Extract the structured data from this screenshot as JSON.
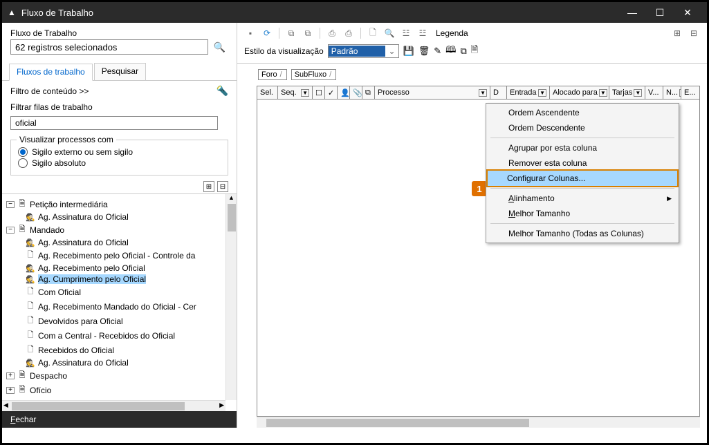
{
  "titlebar": {
    "title": "Fluxo de Trabalho"
  },
  "leftHeader": {
    "label": "Fluxo de Trabalho",
    "searchValue": "62 registros selecionados"
  },
  "tabs": {
    "flow": "Fluxos de trabalho",
    "search": "Pesquisar"
  },
  "filter": {
    "contentLabel": "Filtro de conteúdo >>",
    "queueLabel": "Filtrar filas de trabalho",
    "queueValue": "oficial"
  },
  "vbox": {
    "legend": "Visualizar processos com",
    "radio1": "Sigilo externo ou sem sigilo",
    "radio2": "Sigilo absoluto"
  },
  "tree": {
    "peticao": "Petição intermediária",
    "assinatura1": "Ag. Assinatura do Oficial",
    "mandado": "Mandado",
    "assinatura2": "Ag. Assinatura do Oficial",
    "recControle": "Ag. Recebimento pelo Oficial - Controle da",
    "recOficial": "Ag. Recebimento pelo Oficial",
    "cumprimento": "Ag. Cumprimento pelo Oficial",
    "comOficial": "Com Oficial",
    "recMandado": "Ag. Recebimento Mandado do Oficial - Cer",
    "devolvidos": "Devolvidos para Oficial",
    "comCentral": "Com a Central - Recebidos do Oficial",
    "recebidos": "Recebidos do Oficial",
    "assinatura3": "Ag. Assinatura do Oficial",
    "despacho": "Despacho",
    "oficio": "Ofício"
  },
  "footer": {
    "closeRest": "echar",
    "closeU": "F"
  },
  "toolbar": {
    "legend": "Legenda",
    "styleLabel": "Estilo da visualização",
    "styleValue": "Padrão"
  },
  "crumbs": {
    "foro": "Foro",
    "subfluxo": "SubFluxo"
  },
  "gridHeaders": {
    "sel": "Sel.",
    "seq": "Seq.",
    "processo": "Processo",
    "d": "D",
    "entrada": "Entrada",
    "alocado": "Alocado para",
    "tarjas": "Tarjas",
    "v": "V...",
    "n": "N...",
    "e": "E..."
  },
  "contextMenu": {
    "asc": "Ordem Ascendente",
    "desc": "Ordem Descendente",
    "group": "Agrupar por esta coluna",
    "remove": "Remover esta coluna",
    "configure": "Configurar Colunas...",
    "alignRest": "linhamento",
    "alignU": "A",
    "bestRest": "elhor Tamanho",
    "bestU": "M",
    "bestAll": "Melhor Tamanho (Todas as Colunas)"
  },
  "callout": "1"
}
